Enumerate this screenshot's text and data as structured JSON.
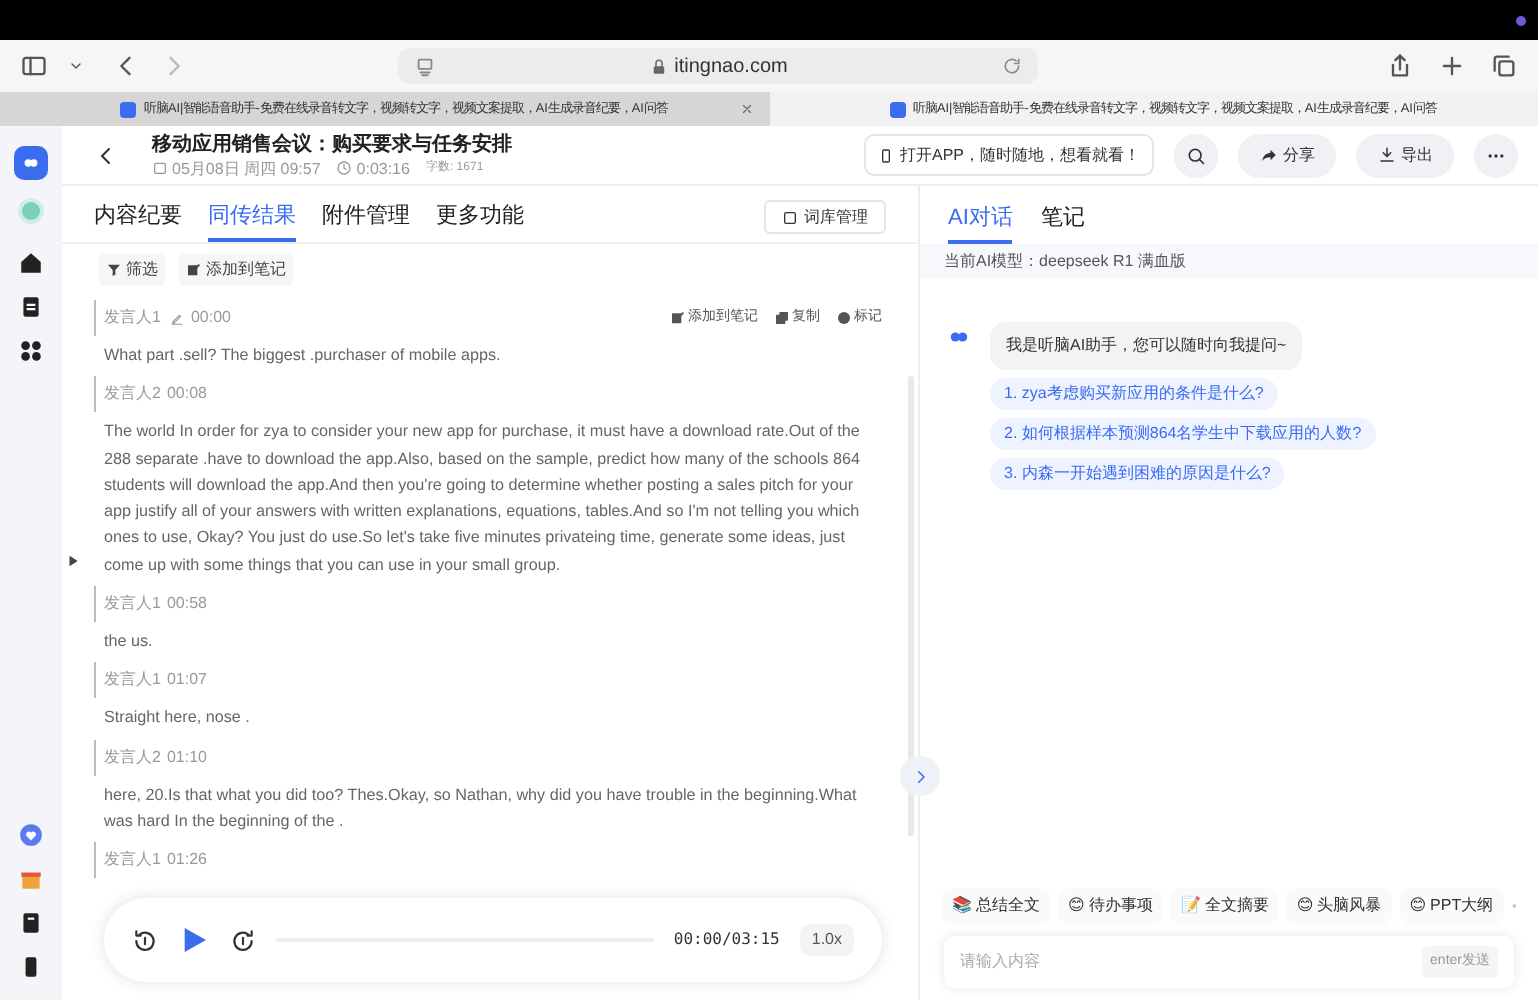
{
  "browser": {
    "url": "itingnao.com",
    "tabs": [
      {
        "title": "听脑AI|智能语音助手-免费在线录音转文字，视频转文字，视频文案提取，AI生成录音纪要，AI问答",
        "selected": true
      },
      {
        "title": "听脑AI|智能语音助手-免费在线录音转文字，视频转文字，视频文案提取，AI生成录音纪要，AI问答",
        "selected": false
      }
    ]
  },
  "meeting": {
    "title": "移动应用销售会议：购买要求与任务安排",
    "date": "05月08日 周四 09:57",
    "duration": "0:03:16",
    "word_count": "字数: 1671"
  },
  "header_actions": {
    "app_banner": "打开APP，随时随地，想看就看！",
    "share": "分享",
    "export": "导出"
  },
  "tabs": [
    {
      "label": "内容纪要",
      "selected": false
    },
    {
      "label": "同传结果",
      "selected": true
    },
    {
      "label": "附件管理",
      "selected": false
    },
    {
      "label": "更多功能",
      "selected": false
    }
  ],
  "glossary_button": "词库管理",
  "toolbar": {
    "filter": "筛选",
    "add_note": "添加到笔记"
  },
  "segment_actions": {
    "add_note": "添加到笔记",
    "copy": "复制",
    "mark": "标记"
  },
  "segments": [
    {
      "speaker": "发言人1",
      "time": "00:00",
      "hovered": true,
      "text": "What part .sell? The biggest .purchaser of mobile apps."
    },
    {
      "speaker": "发言人2",
      "time": "00:08",
      "hovered": false,
      "text": "The world In order for zya to consider your new app for purchase, it must have a download rate.Out of the 288 separate .have to download the app.Also, based on the sample, predict how many of the schools 864 students will download the app.And then you're going to determine whether posting a sales pitch for your app justify all of your answers with written explanations, equations, tables.And so I'm not telling you which ones to use, Okay? You just do use.So let's take five minutes privateing time, generate some ideas, just come up with some things that you can use in your small group."
    },
    {
      "speaker": "发言人1",
      "time": "00:58",
      "hovered": false,
      "text": "the us."
    },
    {
      "speaker": "发言人1",
      "time": "01:07",
      "hovered": false,
      "text": "Straight here, nose ."
    },
    {
      "speaker": "发言人2",
      "time": "01:10",
      "hovered": false,
      "text": "here, 20.Is that what you did too? Thes.Okay, so Nathan, why did you have trouble in the beginning.What was hard In the beginning of the ."
    },
    {
      "speaker": "发言人1",
      "time": "01:26",
      "hovered": false
    }
  ],
  "player": {
    "time": "00:00/03:15",
    "speed": "1.0x",
    "level": 0
  },
  "ai_tabs": [
    {
      "label": "AI对话",
      "selected": true
    },
    {
      "label": "笔记",
      "selected": false
    }
  ],
  "model_info": "当前AI模型：deepseek R1 满血版",
  "greeting": "我是听脑AI助手，您可以随时向我提问~",
  "suggestions": [
    "1. zya考虑购买新应用的条件是什么?",
    "2. 如何根据样本预测864名学生中下载应用的人数?",
    "3. 内森一开始遇到困难的原因是什么?"
  ],
  "quick_actions": [
    {
      "label": "总结全文",
      "emoji": "📚"
    },
    {
      "label": "待办事项",
      "emoji": "😊"
    },
    {
      "label": "全文摘要",
      "emoji": "📝"
    },
    {
      "label": "头脑风暴",
      "emoji": "😊"
    },
    {
      "label": "PPT大纲",
      "emoji": "😊"
    }
  ],
  "chat_input": {
    "placeholder": "请输入内容",
    "send": "enter发送"
  }
}
